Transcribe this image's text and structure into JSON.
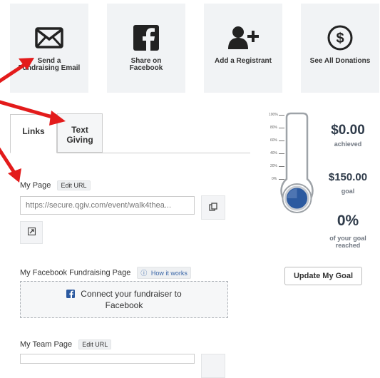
{
  "actions": {
    "email": "Send a Fundraising Email",
    "facebook": "Share on Facebook",
    "registrant": "Add a Registrant",
    "donations": "See All Donations"
  },
  "tabs": {
    "links": "Links",
    "text_giving": "Text Giving"
  },
  "my_page": {
    "label": "My Page",
    "edit": "Edit URL",
    "url_placeholder": "https://secure.qgiv.com/event/walk4thea..."
  },
  "facebook_page": {
    "label": "My Facebook Fundraising Page",
    "how": "How it works",
    "connect": "Connect your fundraiser to Facebook"
  },
  "team_page": {
    "label": "My Team Page",
    "edit": "Edit URL"
  },
  "thermometer": {
    "ticks": [
      "100%",
      "80%",
      "60%",
      "40%",
      "20%",
      "0%"
    ],
    "level_percent": 0
  },
  "stats": {
    "achieved_amount": "$0.00",
    "achieved_label": "achieved",
    "goal_amount": "$150.00",
    "goal_label": "goal",
    "percent": "0%",
    "percent_label": "of your goal reached"
  },
  "update_goal": "Update My Goal",
  "colors": {
    "accent_blue": "#2c5aa0",
    "annotation_red": "#e31b1b",
    "tile_bg": "#f1f3f5"
  }
}
